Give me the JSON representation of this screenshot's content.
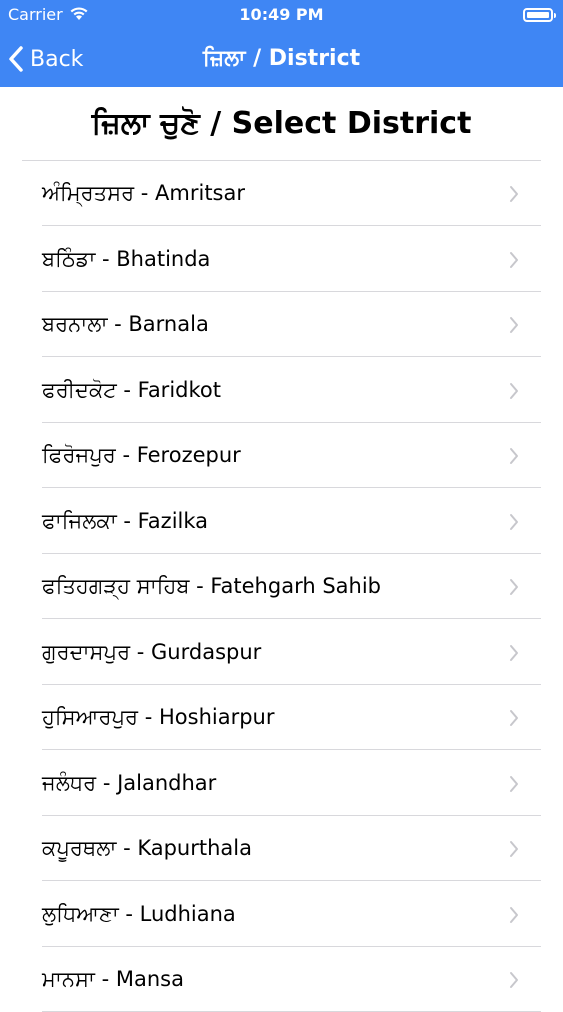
{
  "status_bar": {
    "carrier": "Carrier",
    "time": "10:49 PM"
  },
  "nav": {
    "back_label": "Back",
    "title": "ਜ਼ਿਲਾ / District"
  },
  "heading": "ਜ਼ਿਲਾ ਚੁਣੋ / Select District",
  "districts": [
    "ਅੰਮ੍ਰਿਤਸਰ - Amritsar",
    "ਬਠਿੰਡਾ - Bhatinda",
    "ਬਰਨਾਲਾ - Barnala",
    "ਫਰੀਦਕੋਟ - Faridkot",
    "ਫਿਰੋਜਪੁਰ - Ferozepur",
    "ਫਾਜਿਲਕਾ - Fazilka",
    "ਫਤਿਹਗੜ੍ਹ ਸਾਹਿਬ - Fatehgarh Sahib",
    "ਗੁਰਦਾਸਪੁਰ - Gurdaspur",
    "ਹੁਸਿਆਰਪੁਰ - Hoshiarpur",
    "ਜਲੰਧਰ - Jalandhar",
    "ਕਪੂਰਥਲਾ - Kapurthala",
    "ਲੁਧਿਆਣਾ - Ludhiana",
    "ਮਾਨਸਾ - Mansa"
  ],
  "colors": {
    "nav_background": "#3f86f4",
    "chevron": "#c7c7cc",
    "separator": "#d8d8dc"
  },
  "icons": {
    "back": "chevron-left-icon",
    "row_disclosure": "chevron-right-icon",
    "wifi": "wifi-icon",
    "battery": "battery-icon"
  }
}
